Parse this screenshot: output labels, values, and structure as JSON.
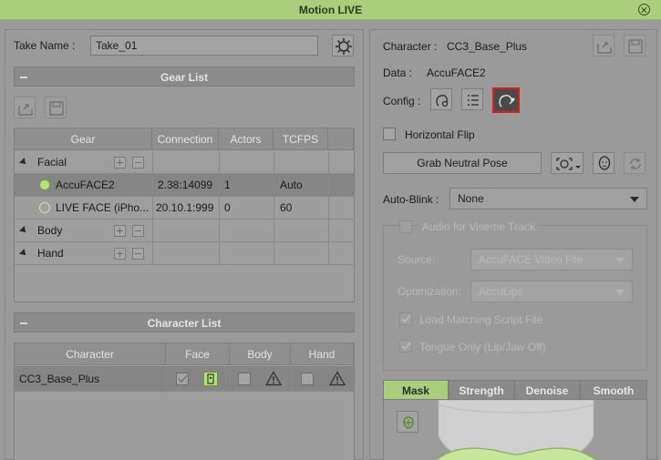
{
  "window": {
    "title": "Motion LIVE"
  },
  "take": {
    "label": "Take Name :",
    "value": "Take_01"
  },
  "gear_list": {
    "title": "Gear List",
    "columns": [
      "Gear",
      "Connection",
      "Actors",
      "TCFPS"
    ],
    "groups": {
      "facial": "Facial",
      "body": "Body",
      "hand": "Hand"
    },
    "rows": [
      {
        "name": "AccuFACE2",
        "connection": "2.38:14099",
        "actors": "1",
        "tcfps": "Auto",
        "status_color": "#b9e07a"
      },
      {
        "name": "LIVE FACE (iPho...",
        "connection": "20.10.1:999",
        "actors": "0",
        "tcfps": "60",
        "status_color": "#9fbf6e"
      }
    ]
  },
  "character_list": {
    "title": "Character List",
    "columns": [
      "Character",
      "Face",
      "Body",
      "Hand"
    ],
    "rows": [
      {
        "name": "CC3_Base_Plus"
      }
    ]
  },
  "right": {
    "character_label": "Character :",
    "character_value": "CC3_Base_Plus",
    "data_label": "Data :",
    "data_value": "AccuFACE2",
    "config_label": "Config :",
    "horizontal_flip": "Horizontal Flip",
    "grab_neutral_pose": "Grab Neutral Pose",
    "auto_blink_label": "Auto-Blink :",
    "auto_blink_value": "None",
    "audio_viseme": "Audio for Viseme Track",
    "source_label": "Source:",
    "source_value": "AccuFACE Video File",
    "optimization_label": "Optimization:",
    "optimization_value": "AccuLips",
    "load_matching_script": "Load Matching Script File",
    "tongue_only": "Tongue Only (Lip/Jaw Off)",
    "tabs": [
      "Mask",
      "Strength",
      "Denoise",
      "Smooth"
    ]
  },
  "colors": {
    "accent": "#a9cf7d",
    "highlight_border": "#d42020"
  }
}
